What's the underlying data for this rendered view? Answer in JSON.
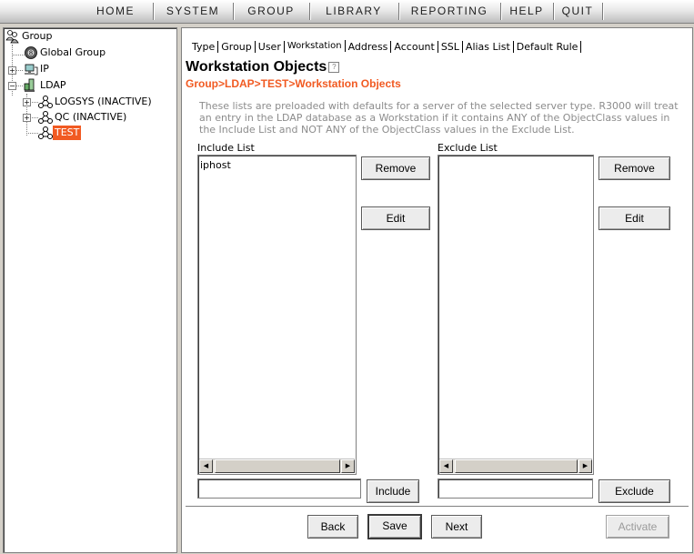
{
  "menu": {
    "items": [
      "HOME",
      "SYSTEM",
      "GROUP",
      "LIBRARY",
      "REPORTING",
      "HELP",
      "QUIT"
    ]
  },
  "tree": {
    "root": "Group",
    "global_group": "Global Group",
    "ip": "IP",
    "ldap": "LDAP",
    "children": [
      "LOGSYS (INACTIVE)",
      "QC (INACTIVE)",
      "TEST"
    ],
    "expand_glyph": "+",
    "collapse_glyph": "−"
  },
  "tabs": [
    "Type",
    "Group",
    "User",
    "Workstation",
    "Address",
    "Account",
    "SSL",
    "Alias List",
    "Default Rule"
  ],
  "active_tab": "Workstation",
  "page": {
    "title": "Workstation Objects",
    "help_glyph": "?",
    "breadcrumb": "Group>LDAP>TEST>Workstation Objects",
    "description": "These lists are preloaded with defaults for a server of the selected server type.  R3000 will treat an entry in the LDAP database as a Workstation if it contains ANY of the ObjectClass values in the Include List and NOT ANY of the ObjectClass values in the Exclude List."
  },
  "include": {
    "label": "Include List",
    "items": [
      "iphost"
    ],
    "input_value": "",
    "remove_label": "Remove",
    "edit_label": "Edit",
    "add_label": "Include"
  },
  "exclude": {
    "label": "Exclude List",
    "items": [],
    "input_value": "",
    "remove_label": "Remove",
    "edit_label": "Edit",
    "add_label": "Exclude"
  },
  "scroll": {
    "left_glyph": "◀",
    "right_glyph": "▶"
  },
  "footer": {
    "back_label": "Back",
    "save_label": "Save",
    "next_label": "Next",
    "activate_label": "Activate"
  },
  "colors": {
    "accent": "#f15a22",
    "panel_bg": "#d4d0c8",
    "desc_text": "#8c8c8c"
  },
  "icons": {
    "root": "users-group-icon",
    "global_group": "globe-icon",
    "ip": "network-computer-icon",
    "ldap": "ldap-server-icon",
    "node": "tree-node-icon"
  }
}
